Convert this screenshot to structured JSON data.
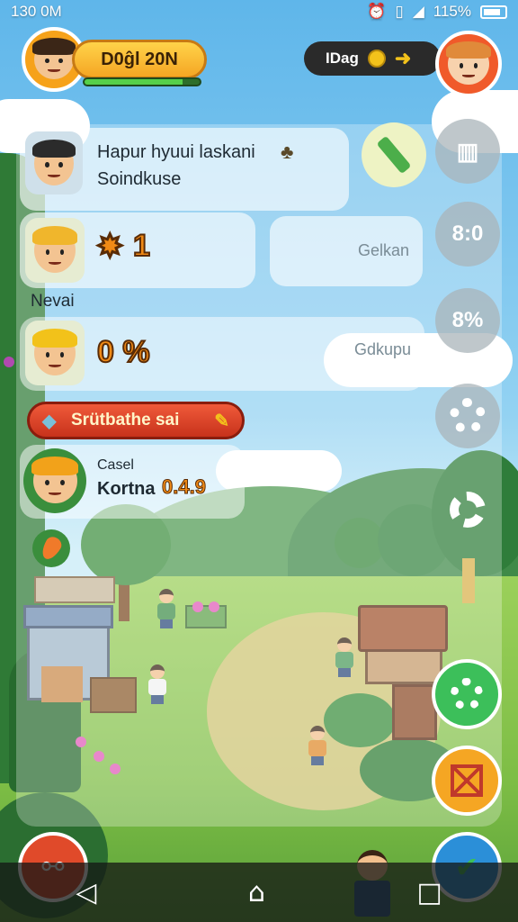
{
  "status_bar": {
    "time": "130 0M",
    "battery": "115%"
  },
  "player": {
    "name": "D0ĝl 20N",
    "xp_fraction": 0.85
  },
  "currency": {
    "label": "IDag"
  },
  "quest": {
    "line1": "Hapur hyuui laskani",
    "line2": "Soindkuse"
  },
  "stats": [
    {
      "value": "1",
      "ghost": "Gelkan"
    },
    {
      "label": "Nevai"
    },
    {
      "value": "0 %",
      "ghost": "Gdkupu"
    }
  ],
  "action": {
    "label": "Srütbathe sai"
  },
  "info": {
    "line1": "Casel",
    "line2": "Kortna",
    "version": "0.4.9"
  },
  "side_buttons": {
    "b2": "8:0",
    "b3": "8%"
  },
  "colors": {
    "accent": "#f5a623",
    "danger": "#e04a2a",
    "ok": "#3cbf5a",
    "info": "#2b8fd8"
  }
}
